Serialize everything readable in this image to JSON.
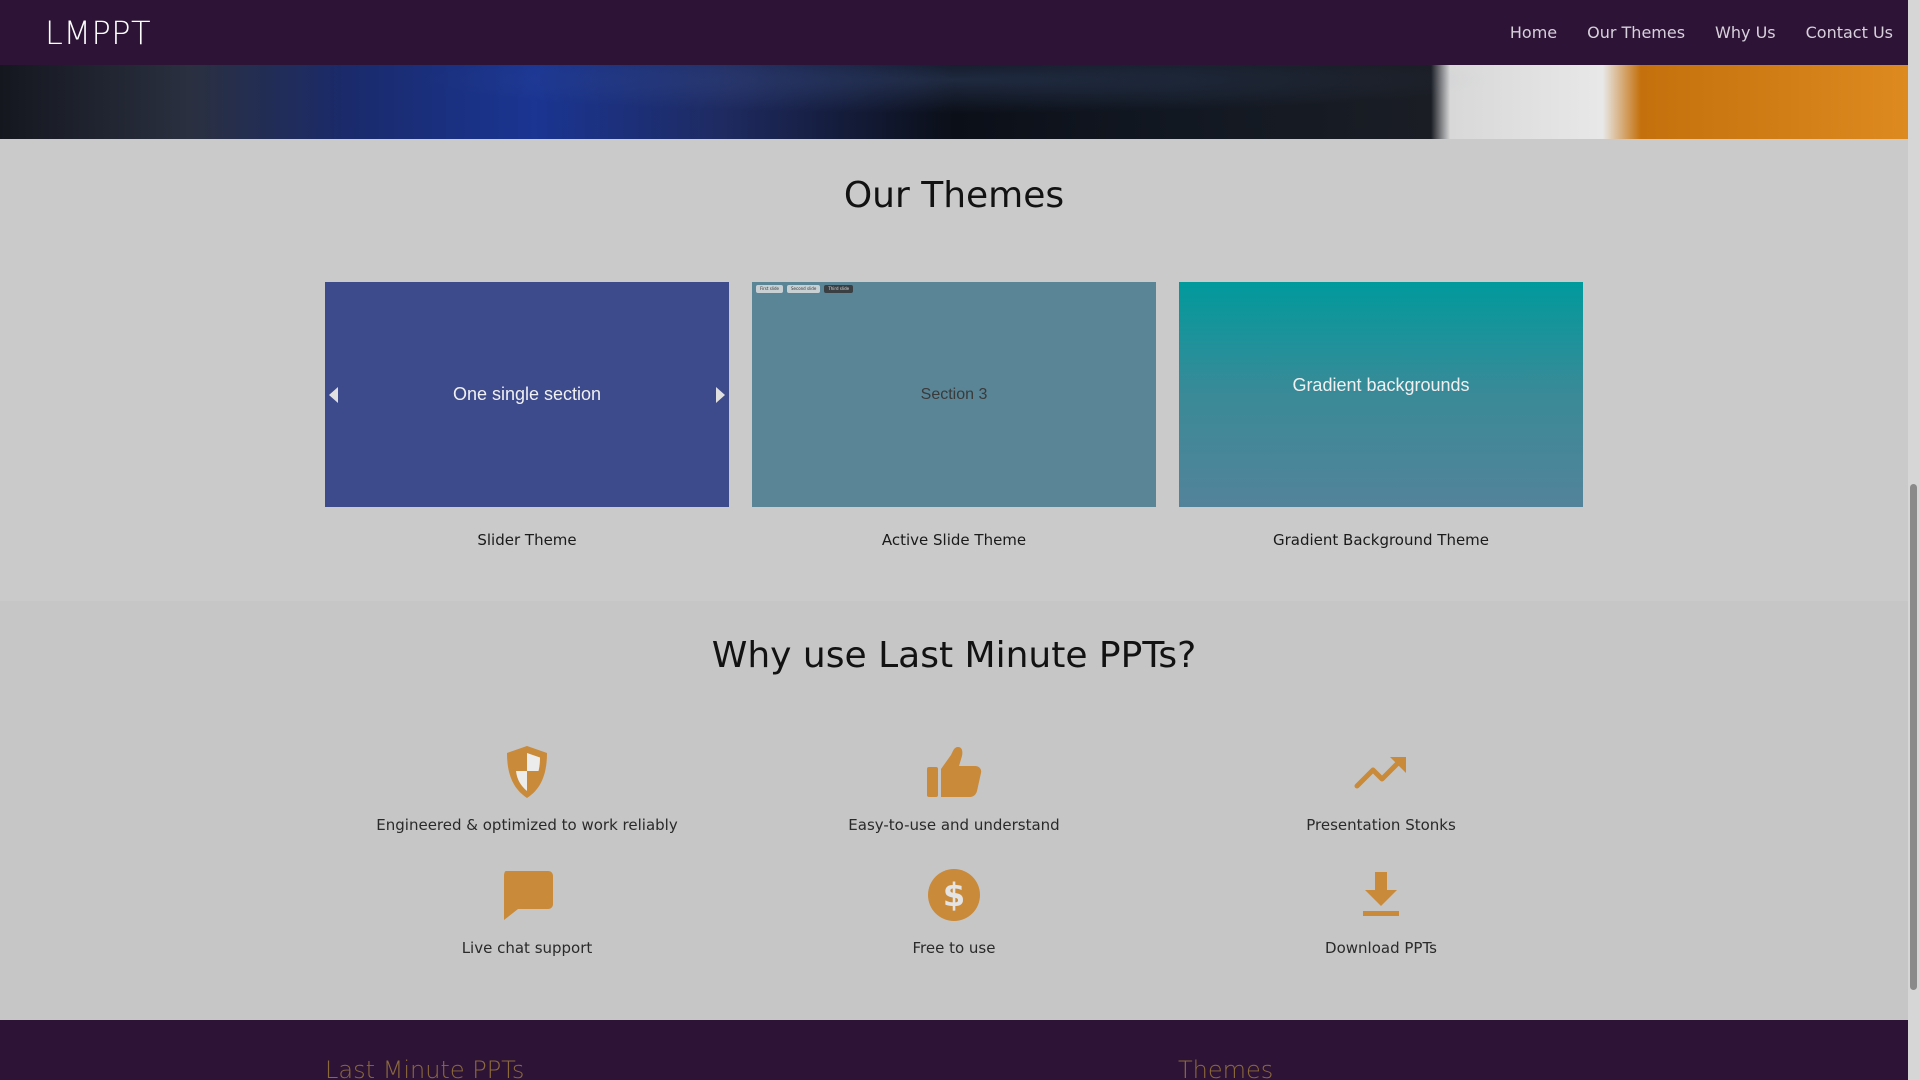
{
  "navbar": {
    "brand": "LMPPT",
    "links": [
      "Home",
      "Our Themes",
      "Why Us",
      "Contact Us"
    ]
  },
  "themes": {
    "title": "Our Themes",
    "cards": [
      {
        "image_text": "One single section",
        "label": "Slider Theme"
      },
      {
        "image_text": "Section 3",
        "label": "Active Slide Theme",
        "mini_tabs": [
          "First slide",
          "Second slide",
          "Third slide"
        ]
      },
      {
        "image_text": "Gradient backgrounds",
        "label": "Gradient Background Theme"
      }
    ]
  },
  "why": {
    "title": "Why use Last Minute PPTs?",
    "features": [
      {
        "icon": "shield-icon",
        "text": "Engineered & optimized to work reliably"
      },
      {
        "icon": "thumbs-up-icon",
        "text": "Easy-to-use and understand"
      },
      {
        "icon": "trending-up-icon",
        "text": "Presentation Stonks"
      },
      {
        "icon": "chat-icon",
        "text": "Live chat support"
      },
      {
        "icon": "dollar-icon",
        "text": "Free to use"
      },
      {
        "icon": "download-icon",
        "text": "Download PPTs"
      }
    ],
    "icon_color": "#c98a3a"
  },
  "footer": {
    "headings": [
      "Last Minute PPTs",
      "Themes"
    ]
  },
  "colors": {
    "navbar": "#2d1437",
    "accent": "#c98a3a"
  }
}
